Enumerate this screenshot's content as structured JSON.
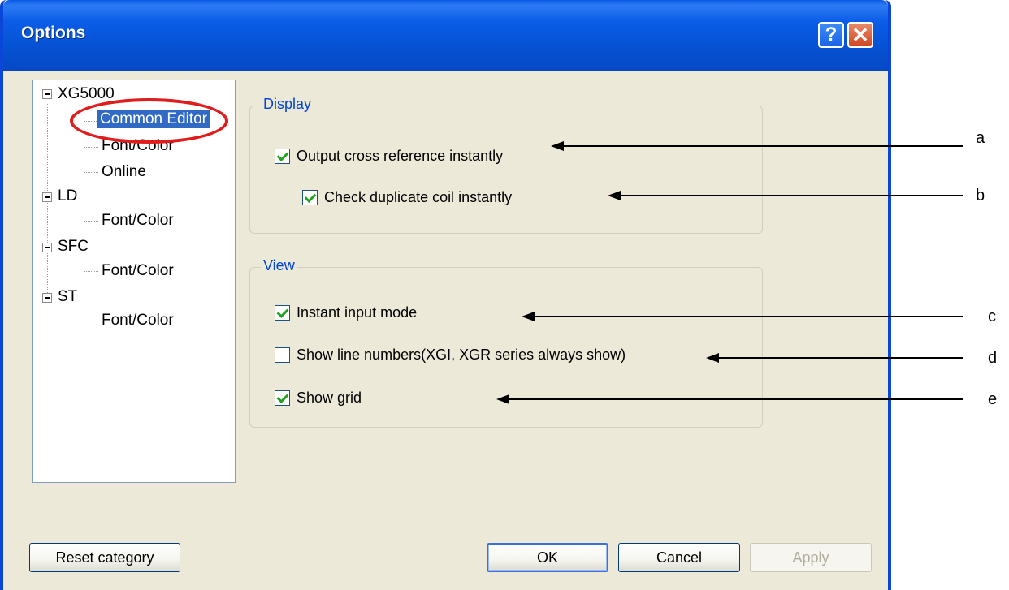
{
  "window": {
    "title": "Options",
    "help_label": "?",
    "close_label": "✕"
  },
  "tree": {
    "root": "XG5000",
    "items": [
      {
        "label": "Common Editor",
        "selected": true
      },
      {
        "label": "Font/Color"
      },
      {
        "label": "Online"
      },
      {
        "label": "LD"
      },
      {
        "label": "Font/Color"
      },
      {
        "label": "SFC"
      },
      {
        "label": "Font/Color"
      },
      {
        "label": "ST"
      },
      {
        "label": "Font/Color"
      }
    ]
  },
  "display": {
    "legend": "Display",
    "options": [
      {
        "label": "Output cross reference instantly",
        "checked": true
      },
      {
        "label": "Check duplicate coil instantly",
        "checked": true
      }
    ]
  },
  "view": {
    "legend": "View",
    "options": [
      {
        "label": "Instant input mode",
        "checked": true
      },
      {
        "label": "Show line numbers(XGI, XGR series always show)",
        "checked": false
      },
      {
        "label": "Show grid",
        "checked": true
      }
    ]
  },
  "buttons": {
    "reset": "Reset category",
    "ok": "OK",
    "cancel": "Cancel",
    "apply": "Apply"
  },
  "annotations": {
    "a": "a",
    "b": "b",
    "c": "c",
    "d": "d",
    "e": "e"
  },
  "colors": {
    "titlebar": "#0a5ae6",
    "selection": "#316ac5",
    "legend": "#0046d5",
    "highlight": "#e01c1c",
    "check": "#21a121"
  }
}
